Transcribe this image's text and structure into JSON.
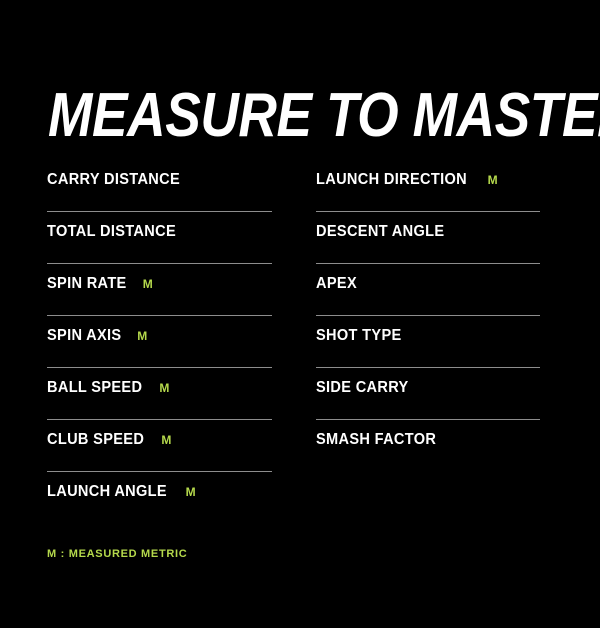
{
  "title": "MEASURE TO MASTER",
  "colors": {
    "background": "#000000",
    "text": "#ffffff",
    "accent": "#b5d94c",
    "divider": "#8d8d8d"
  },
  "columns": {
    "left": [
      {
        "label": "CARRY DISTANCE",
        "badge": "",
        "measured": false
      },
      {
        "label": "TOTAL DISTANCE",
        "badge": "",
        "measured": false
      },
      {
        "label": "SPIN RATE",
        "badge": "M",
        "measured": true
      },
      {
        "label": "SPIN AXIS",
        "badge": "M",
        "measured": true
      },
      {
        "label": "BALL SPEED",
        "badge": "M",
        "measured": true
      },
      {
        "label": "CLUB SPEED",
        "badge": "M",
        "measured": true
      },
      {
        "label": "LAUNCH ANGLE",
        "badge": "M",
        "measured": true
      }
    ],
    "right": [
      {
        "label": "LAUNCH DIRECTION",
        "badge": "M",
        "measured": true
      },
      {
        "label": "DESCENT ANGLE",
        "badge": "",
        "measured": false
      },
      {
        "label": "APEX",
        "badge": "",
        "measured": false
      },
      {
        "label": "SHOT TYPE",
        "badge": "",
        "measured": false
      },
      {
        "label": "SIDE CARRY",
        "badge": "",
        "measured": false
      },
      {
        "label": "SMASH FACTOR",
        "badge": "",
        "measured": false
      }
    ]
  },
  "legend": "M : MEASURED METRIC"
}
